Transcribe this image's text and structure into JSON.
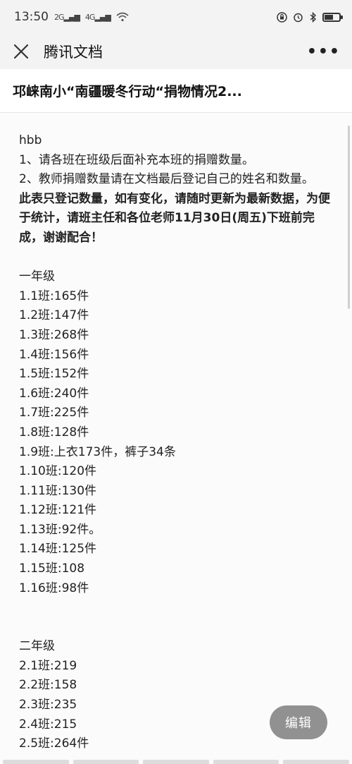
{
  "status": {
    "time": "13:50",
    "signal1": "2G",
    "signal2": "4G",
    "icons": [
      "wifi-icon",
      "lock-icon",
      "alarm-icon",
      "bluetooth-icon",
      "battery-icon"
    ]
  },
  "nav": {
    "title": "腾讯文档",
    "close_icon": "close-icon",
    "more_label": "•••"
  },
  "doc": {
    "title": "邛崃南小“南疆暖冬行动“捐物情况2..."
  },
  "content": {
    "intro": "hbb",
    "note1": "1、请各班在班级后面补充本班的捐赠数量。",
    "note2": "2、教师捐赠数量请在文档最后登记自己的姓名和数量。",
    "bold_notice": "此表只登记数量，如有变化，请随时更新为最新数据，为便于统计，请班主任和各位老师11月30日(周五)下班前完成，谢谢配合！",
    "grade1": {
      "heading": "一年级",
      "items": [
        "1.1班:165件",
        "1.2班:147件",
        "1.3班:268件",
        "1.4班:156件",
        "1.5班:152件",
        "1.6班:240件",
        "1.7班:225件",
        "1.8班:128件",
        "1.9班:上衣173件，裤子34条",
        "1.10班:120件",
        "1.11班:130件",
        "1.12班:121件",
        "1.13班:92件。",
        "1.14班:125件",
        "1.15班:108",
        "1.16班:98件"
      ]
    },
    "grade2": {
      "heading": "二年级",
      "items": [
        "2.1班:219",
        "2.2班:158",
        "2.3班:235",
        "2.4班:215",
        "2.5班:264件"
      ]
    }
  },
  "edit_button": {
    "label": "编辑"
  }
}
